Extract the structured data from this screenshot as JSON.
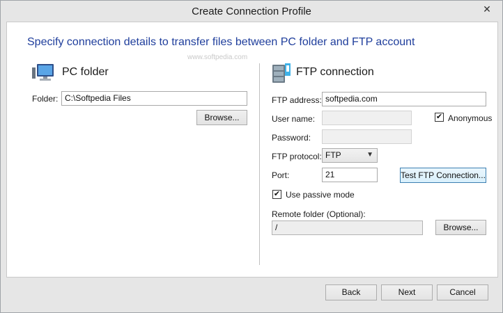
{
  "window": {
    "title": "Create Connection Profile",
    "close_glyph": "✕"
  },
  "heading": "Specify connection details to transfer files between PC folder and FTP account",
  "watermark": "www.softpedia.com",
  "pc": {
    "title": "PC folder",
    "icon": "computer-icon",
    "folder_label": "Folder:",
    "folder_value": "C:\\Softpedia Files",
    "browse_label": "Browse..."
  },
  "ftp": {
    "title": "FTP connection",
    "icon": "server-icon",
    "address_label": "FTP address:",
    "address_value": "softpedia.com",
    "username_label": "User name:",
    "username_value": "",
    "anonymous_label": "Anonymous",
    "anonymous_checked": true,
    "password_label": "Password:",
    "password_value": "",
    "protocol_label": "FTP protocol:",
    "protocol_value": "FTP",
    "port_label": "Port:",
    "port_value": "21",
    "test_label": "Test FTP Connection...",
    "passive_label": "Use passive mode",
    "passive_checked": true,
    "remote_label": "Remote folder (Optional):",
    "remote_value": "/",
    "browse_label": "Browse..."
  },
  "footer": {
    "back": "Back",
    "next": "Next",
    "cancel": "Cancel"
  },
  "check_glyph": "✔"
}
